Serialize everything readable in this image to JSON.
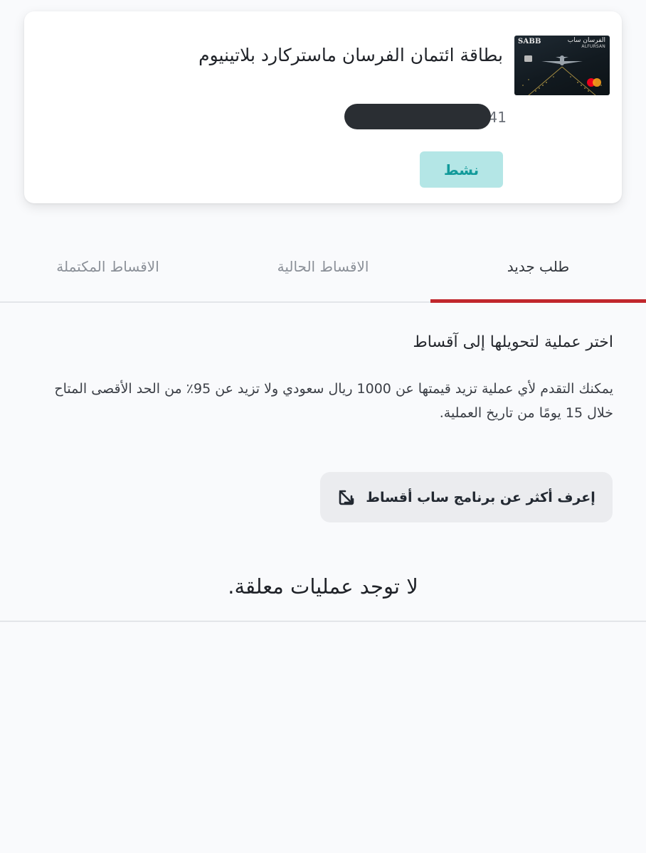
{
  "card": {
    "title": "بطاقة ائتمان الفرسان ماستركارد بلاتينيوم",
    "number_suffix": "41",
    "status": "نشط",
    "image": {
      "brand_en": "SABB",
      "brand_ar": "الفرسان ساب",
      "brand_sub": "ALFURSAN",
      "network": "mastercard"
    }
  },
  "tabs": [
    {
      "label": "طلب جديد",
      "active": true
    },
    {
      "label": "الاقساط الحالية",
      "active": false
    },
    {
      "label": "الاقساط المكتملة",
      "active": false
    }
  ],
  "content": {
    "heading": "اختر عملية لتحويلها إلى آقساط",
    "description": "يمكنك التقدم لأي عملية تزيد قيمتها عن 1000 ريال سعودي ولا تزيد عن 95٪ من الحد الأقصى المتاح خلال 15 يومًا من تاريخ العملية.",
    "learn_more_label": "إعرف أكثر عن برنامج ساب أقساط",
    "empty_state": "لا توجد عمليات معلقة."
  },
  "colors": {
    "accent": "#c1272d",
    "status_bg": "#b4e6e6",
    "status_text": "#129a9a",
    "background": "#f9fafc"
  }
}
